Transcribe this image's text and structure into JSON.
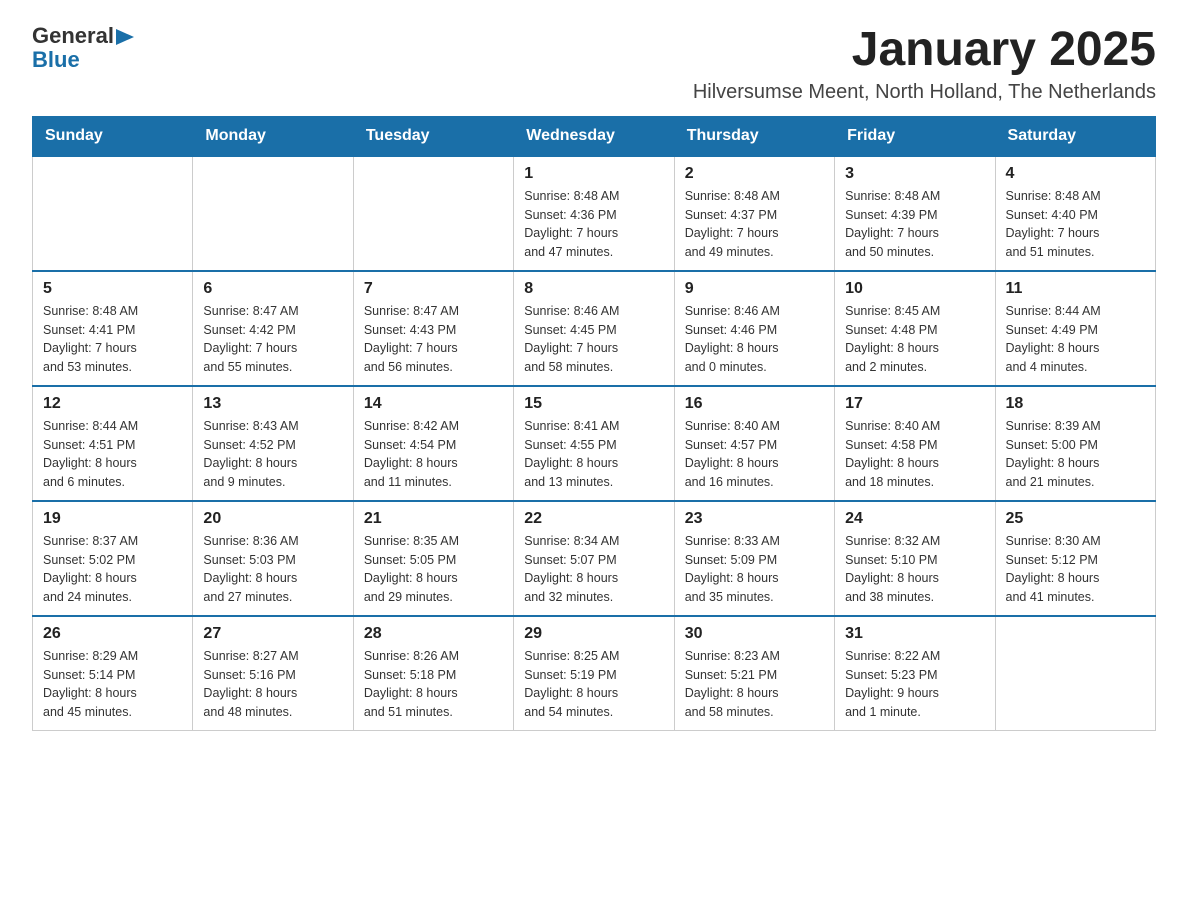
{
  "logo": {
    "general": "General",
    "blue": "Blue",
    "triangle": "▶"
  },
  "title": "January 2025",
  "subtitle": "Hilversumse Meent, North Holland, The Netherlands",
  "header_color": "#1a6fa8",
  "days_of_week": [
    "Sunday",
    "Monday",
    "Tuesday",
    "Wednesday",
    "Thursday",
    "Friday",
    "Saturday"
  ],
  "weeks": [
    [
      {
        "day": "",
        "info": ""
      },
      {
        "day": "",
        "info": ""
      },
      {
        "day": "",
        "info": ""
      },
      {
        "day": "1",
        "info": "Sunrise: 8:48 AM\nSunset: 4:36 PM\nDaylight: 7 hours\nand 47 minutes."
      },
      {
        "day": "2",
        "info": "Sunrise: 8:48 AM\nSunset: 4:37 PM\nDaylight: 7 hours\nand 49 minutes."
      },
      {
        "day": "3",
        "info": "Sunrise: 8:48 AM\nSunset: 4:39 PM\nDaylight: 7 hours\nand 50 minutes."
      },
      {
        "day": "4",
        "info": "Sunrise: 8:48 AM\nSunset: 4:40 PM\nDaylight: 7 hours\nand 51 minutes."
      }
    ],
    [
      {
        "day": "5",
        "info": "Sunrise: 8:48 AM\nSunset: 4:41 PM\nDaylight: 7 hours\nand 53 minutes."
      },
      {
        "day": "6",
        "info": "Sunrise: 8:47 AM\nSunset: 4:42 PM\nDaylight: 7 hours\nand 55 minutes."
      },
      {
        "day": "7",
        "info": "Sunrise: 8:47 AM\nSunset: 4:43 PM\nDaylight: 7 hours\nand 56 minutes."
      },
      {
        "day": "8",
        "info": "Sunrise: 8:46 AM\nSunset: 4:45 PM\nDaylight: 7 hours\nand 58 minutes."
      },
      {
        "day": "9",
        "info": "Sunrise: 8:46 AM\nSunset: 4:46 PM\nDaylight: 8 hours\nand 0 minutes."
      },
      {
        "day": "10",
        "info": "Sunrise: 8:45 AM\nSunset: 4:48 PM\nDaylight: 8 hours\nand 2 minutes."
      },
      {
        "day": "11",
        "info": "Sunrise: 8:44 AM\nSunset: 4:49 PM\nDaylight: 8 hours\nand 4 minutes."
      }
    ],
    [
      {
        "day": "12",
        "info": "Sunrise: 8:44 AM\nSunset: 4:51 PM\nDaylight: 8 hours\nand 6 minutes."
      },
      {
        "day": "13",
        "info": "Sunrise: 8:43 AM\nSunset: 4:52 PM\nDaylight: 8 hours\nand 9 minutes."
      },
      {
        "day": "14",
        "info": "Sunrise: 8:42 AM\nSunset: 4:54 PM\nDaylight: 8 hours\nand 11 minutes."
      },
      {
        "day": "15",
        "info": "Sunrise: 8:41 AM\nSunset: 4:55 PM\nDaylight: 8 hours\nand 13 minutes."
      },
      {
        "day": "16",
        "info": "Sunrise: 8:40 AM\nSunset: 4:57 PM\nDaylight: 8 hours\nand 16 minutes."
      },
      {
        "day": "17",
        "info": "Sunrise: 8:40 AM\nSunset: 4:58 PM\nDaylight: 8 hours\nand 18 minutes."
      },
      {
        "day": "18",
        "info": "Sunrise: 8:39 AM\nSunset: 5:00 PM\nDaylight: 8 hours\nand 21 minutes."
      }
    ],
    [
      {
        "day": "19",
        "info": "Sunrise: 8:37 AM\nSunset: 5:02 PM\nDaylight: 8 hours\nand 24 minutes."
      },
      {
        "day": "20",
        "info": "Sunrise: 8:36 AM\nSunset: 5:03 PM\nDaylight: 8 hours\nand 27 minutes."
      },
      {
        "day": "21",
        "info": "Sunrise: 8:35 AM\nSunset: 5:05 PM\nDaylight: 8 hours\nand 29 minutes."
      },
      {
        "day": "22",
        "info": "Sunrise: 8:34 AM\nSunset: 5:07 PM\nDaylight: 8 hours\nand 32 minutes."
      },
      {
        "day": "23",
        "info": "Sunrise: 8:33 AM\nSunset: 5:09 PM\nDaylight: 8 hours\nand 35 minutes."
      },
      {
        "day": "24",
        "info": "Sunrise: 8:32 AM\nSunset: 5:10 PM\nDaylight: 8 hours\nand 38 minutes."
      },
      {
        "day": "25",
        "info": "Sunrise: 8:30 AM\nSunset: 5:12 PM\nDaylight: 8 hours\nand 41 minutes."
      }
    ],
    [
      {
        "day": "26",
        "info": "Sunrise: 8:29 AM\nSunset: 5:14 PM\nDaylight: 8 hours\nand 45 minutes."
      },
      {
        "day": "27",
        "info": "Sunrise: 8:27 AM\nSunset: 5:16 PM\nDaylight: 8 hours\nand 48 minutes."
      },
      {
        "day": "28",
        "info": "Sunrise: 8:26 AM\nSunset: 5:18 PM\nDaylight: 8 hours\nand 51 minutes."
      },
      {
        "day": "29",
        "info": "Sunrise: 8:25 AM\nSunset: 5:19 PM\nDaylight: 8 hours\nand 54 minutes."
      },
      {
        "day": "30",
        "info": "Sunrise: 8:23 AM\nSunset: 5:21 PM\nDaylight: 8 hours\nand 58 minutes."
      },
      {
        "day": "31",
        "info": "Sunrise: 8:22 AM\nSunset: 5:23 PM\nDaylight: 9 hours\nand 1 minute."
      },
      {
        "day": "",
        "info": ""
      }
    ]
  ]
}
